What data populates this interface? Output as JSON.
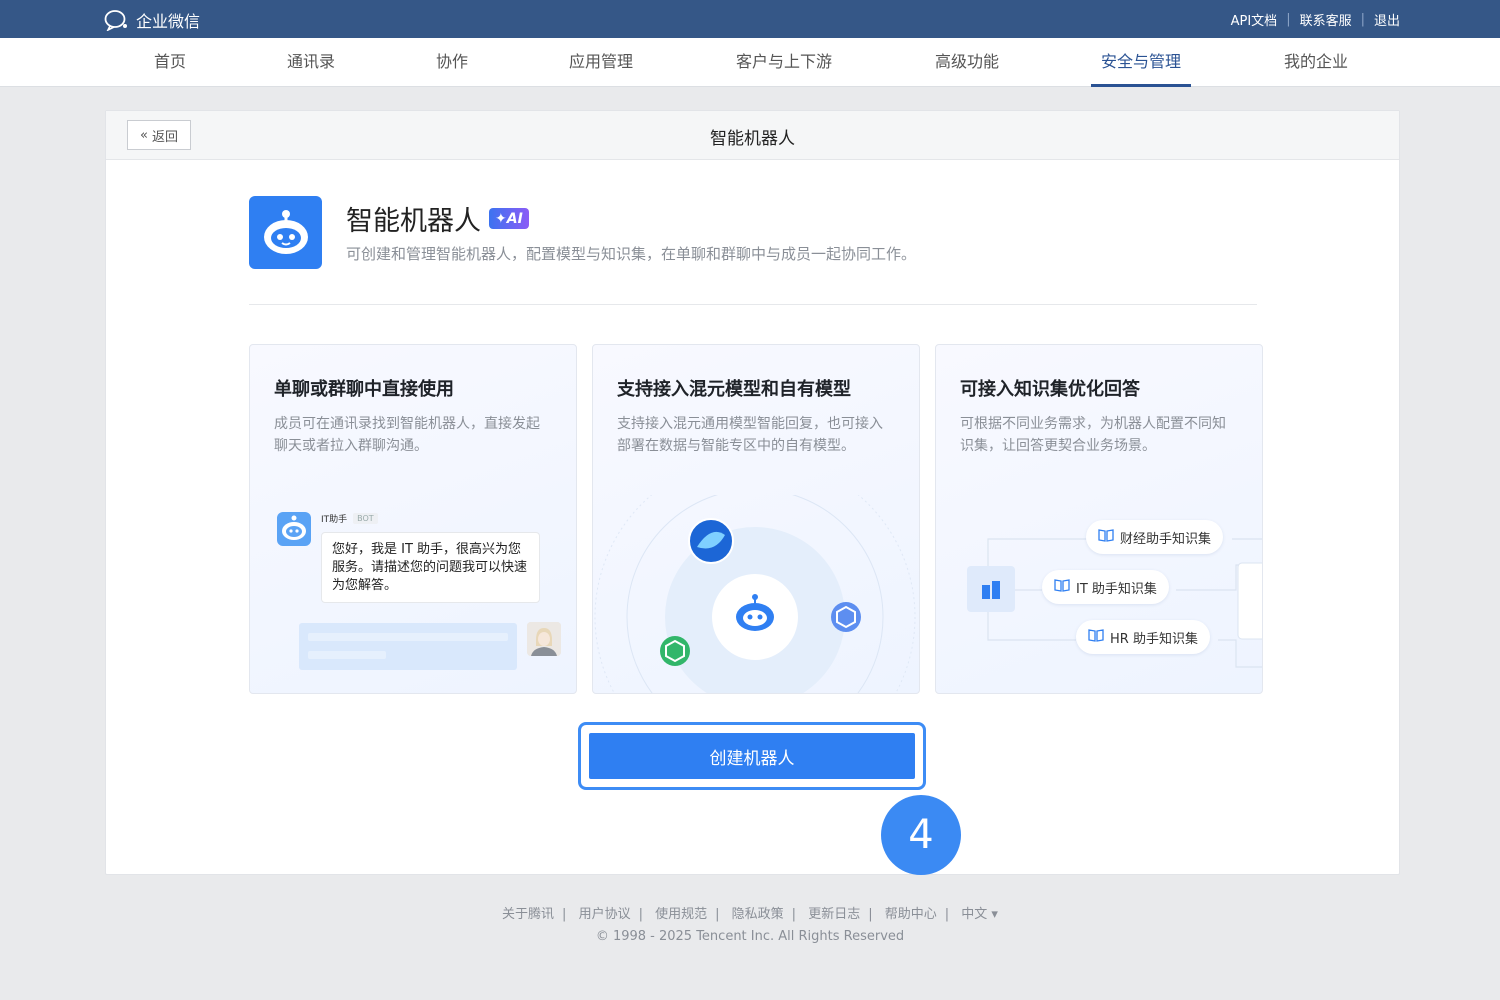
{
  "topbar": {
    "logo_text": "企业微信",
    "links": [
      "API文档",
      "联系客服",
      "退出"
    ]
  },
  "nav": {
    "items": [
      "首页",
      "通讯录",
      "协作",
      "应用管理",
      "客户与上下游",
      "高级功能",
      "安全与管理",
      "我的企业"
    ],
    "active": "安全与管理"
  },
  "panel": {
    "back_label": "返回",
    "title": "智能机器人"
  },
  "app": {
    "name": "智能机器人",
    "badge": "AI",
    "description": "可创建和管理智能机器人，配置模型与知识集，在单聊和群聊中与成员一起协同工作。"
  },
  "cards": [
    {
      "title": "单聊或群聊中直接使用",
      "desc": "成员可在通讯录找到智能机器人，直接发起聊天或者拉入群聊沟通。",
      "chat": {
        "bot_name": "IT助手",
        "bot_tag": "BOT",
        "message": "您好，我是 IT 助手，很高兴为您服务。请描述您的问题我可以快速为您解答。"
      }
    },
    {
      "title": "支持接入混元模型和自有模型",
      "desc": "支持接入混元通用模型智能回复，也可接入部署在数据与智能专区中的自有模型。"
    },
    {
      "title": "可接入知识集优化回答",
      "desc": "可根据不同业务需求，为机器人配置不同知识集，让回答更契合业务场景。",
      "knowledge_sets": [
        "财经助手知识集",
        "IT 助手知识集",
        "HR 助手知识集"
      ]
    }
  ],
  "create_button": "创建机器人",
  "step_number": "4",
  "footer": {
    "links": [
      "关于腾讯",
      "用户协议",
      "使用规范",
      "隐私政策",
      "更新日志",
      "帮助中心",
      "中文 ▾"
    ],
    "copyright": "© 1998 - 2025 Tencent Inc. All Rights Reserved"
  },
  "colors": {
    "topbar": "#355787",
    "nav_active": "#2a5293",
    "primary": "#2f7ff2",
    "step_circle": "#3b8af3"
  }
}
